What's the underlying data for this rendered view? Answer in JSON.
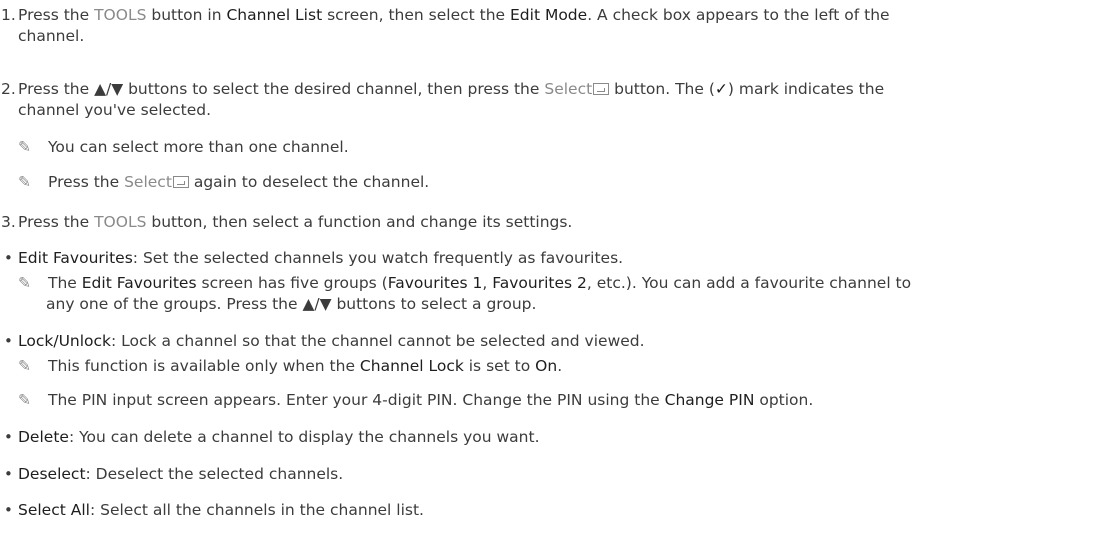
{
  "steps": [
    {
      "num": "1.",
      "l1": "Press the ",
      "k1": "TOOLS",
      "l2": " button in ",
      "b1": "Channel List",
      "l3": " screen, then select the ",
      "b2": "Edit Mode",
      "l4": ". A check box appears to the left of the",
      "cont": "channel."
    },
    {
      "num": "2.",
      "l1": "Press the ▲/▼ buttons to select the desired channel, then press the ",
      "k1": "Select",
      "l2": " button. The (",
      "check": "✓",
      "l3": ") mark indicates the",
      "cont": "channel you've selected.",
      "notes": [
        "You can select more than one channel.",
        {
          "a": "Press the ",
          "k": "Select",
          "b": " again to deselect the channel."
        }
      ]
    },
    {
      "num": "3.",
      "l1": "Press the ",
      "k1": "TOOLS",
      "l2": " button, then select a function and change its settings."
    }
  ],
  "note_glyph": "✎",
  "bullet_glyph": "•",
  "functions": [
    {
      "name": "Edit Favourites",
      "desc": ": Set the selected channels you watch frequently as favourites.",
      "note": {
        "a": "The ",
        "b1": "Edit Favourites",
        "c": " screen has five groups (",
        "b2": "Favourites 1",
        "d": ", ",
        "b3": "Favourites 2",
        "e": ", etc.). You can add a favourite channel to",
        "cont": "any one of the groups. Press the ▲/▼ buttons to select a group."
      }
    },
    {
      "name": "Lock/Unlock",
      "desc": ": Lock a channel so that the channel cannot be selected and viewed.",
      "notes": [
        {
          "a": "This function is available only when the ",
          "b1": "Channel Lock",
          "c": " is set to ",
          "b2": "On",
          "d": "."
        },
        {
          "a": "The PIN input screen appears. Enter your 4-digit PIN. Change the PIN using the ",
          "b1": "Change PIN",
          "c": " option."
        }
      ]
    },
    {
      "name": "Delete",
      "desc": ": You can delete a channel to display the channels you want."
    },
    {
      "name": "Deselect",
      "desc": ": Deselect the selected channels."
    },
    {
      "name": "Select All",
      "desc": ": Select all the channels in the channel list."
    }
  ]
}
